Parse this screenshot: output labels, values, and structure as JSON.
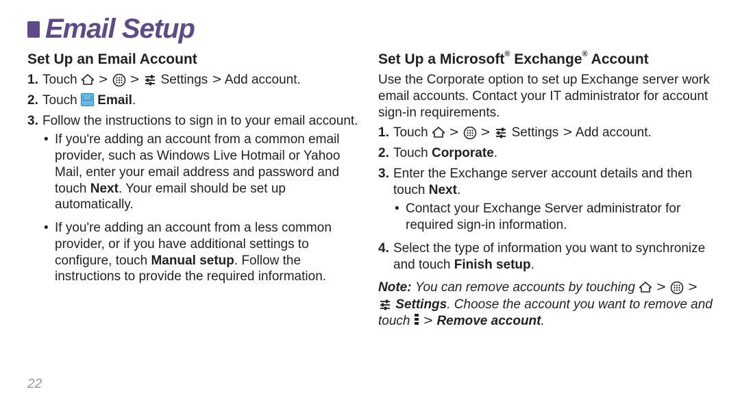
{
  "title": "Email Setup",
  "page_number": "22",
  "left": {
    "heading": "Set Up an Email Account",
    "step1_a": "Touch ",
    "step1_settings": " Settings ",
    "step1_add": " Add account",
    "step2_a": "Touch ",
    "step2_b": " Email",
    "step3": "Follow the instructions to sign in to your email account.",
    "bullet1_a": "If you're adding an account from a common email provider, such as Windows Live Hotmail or Yahoo Mail, enter your email address and password and touch ",
    "bullet1_b": "Next",
    "bullet1_c": ". Your email should be set up automatically.",
    "bullet2_a": "If you're adding an account from a less common provider, or if you have additional settings to configure, touch ",
    "bullet2_b": "Manual setup",
    "bullet2_c": ". Follow the instructions to provide the required information."
  },
  "right": {
    "heading_a": "Set Up a Microsoft",
    "heading_b": " Exchange",
    "heading_c": " Account",
    "intro": "Use the Corporate option to set up Exchange server work email accounts. Contact your IT administrator for account sign-in requirements.",
    "step1_a": "Touch ",
    "step1_settings": " Settings ",
    "step1_add": " Add account",
    "step2_a": "Touch ",
    "step2_b": "Corporate",
    "step3_a": "Enter the Exchange server account details and then touch ",
    "step3_b": "Next",
    "bullet1": "Contact your Exchange Server administrator for required sign-in information.",
    "step4_a": "Select the type of information you want to synchronize and touch ",
    "step4_b": "Finish setup",
    "note_a": "Note: ",
    "note_b": "You can remove accounts by touching ",
    "note_c": " Settings",
    "note_d": ". Choose the account you want to remove and touch ",
    "note_e": " Remove account",
    "note_f": "."
  }
}
